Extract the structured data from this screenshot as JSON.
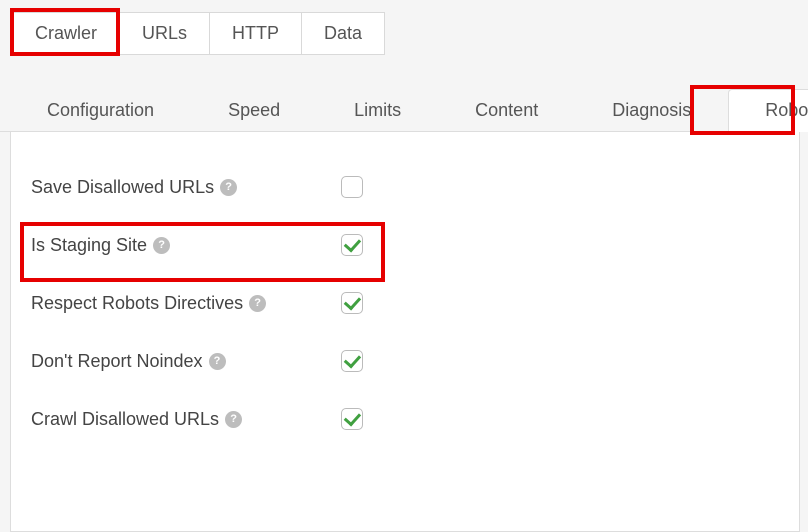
{
  "main_tabs": {
    "crawler": "Crawler",
    "urls": "URLs",
    "http": "HTTP",
    "data": "Data",
    "active": "crawler"
  },
  "sub_tabs": {
    "configuration": "Configuration",
    "speed": "Speed",
    "limits": "Limits",
    "content": "Content",
    "diagnosis": "Diagnosis",
    "robots": "Robots",
    "active": "robots"
  },
  "options": {
    "save_disallowed": {
      "label": "Save Disallowed URLs",
      "checked": false
    },
    "is_staging": {
      "label": "Is Staging Site",
      "checked": true
    },
    "respect_robots": {
      "label": "Respect Robots Directives",
      "checked": true
    },
    "dont_report": {
      "label": "Don't Report Noindex",
      "checked": true
    },
    "crawl_disallowed": {
      "label": "Crawl Disallowed URLs",
      "checked": true
    }
  },
  "help_glyph": "?"
}
